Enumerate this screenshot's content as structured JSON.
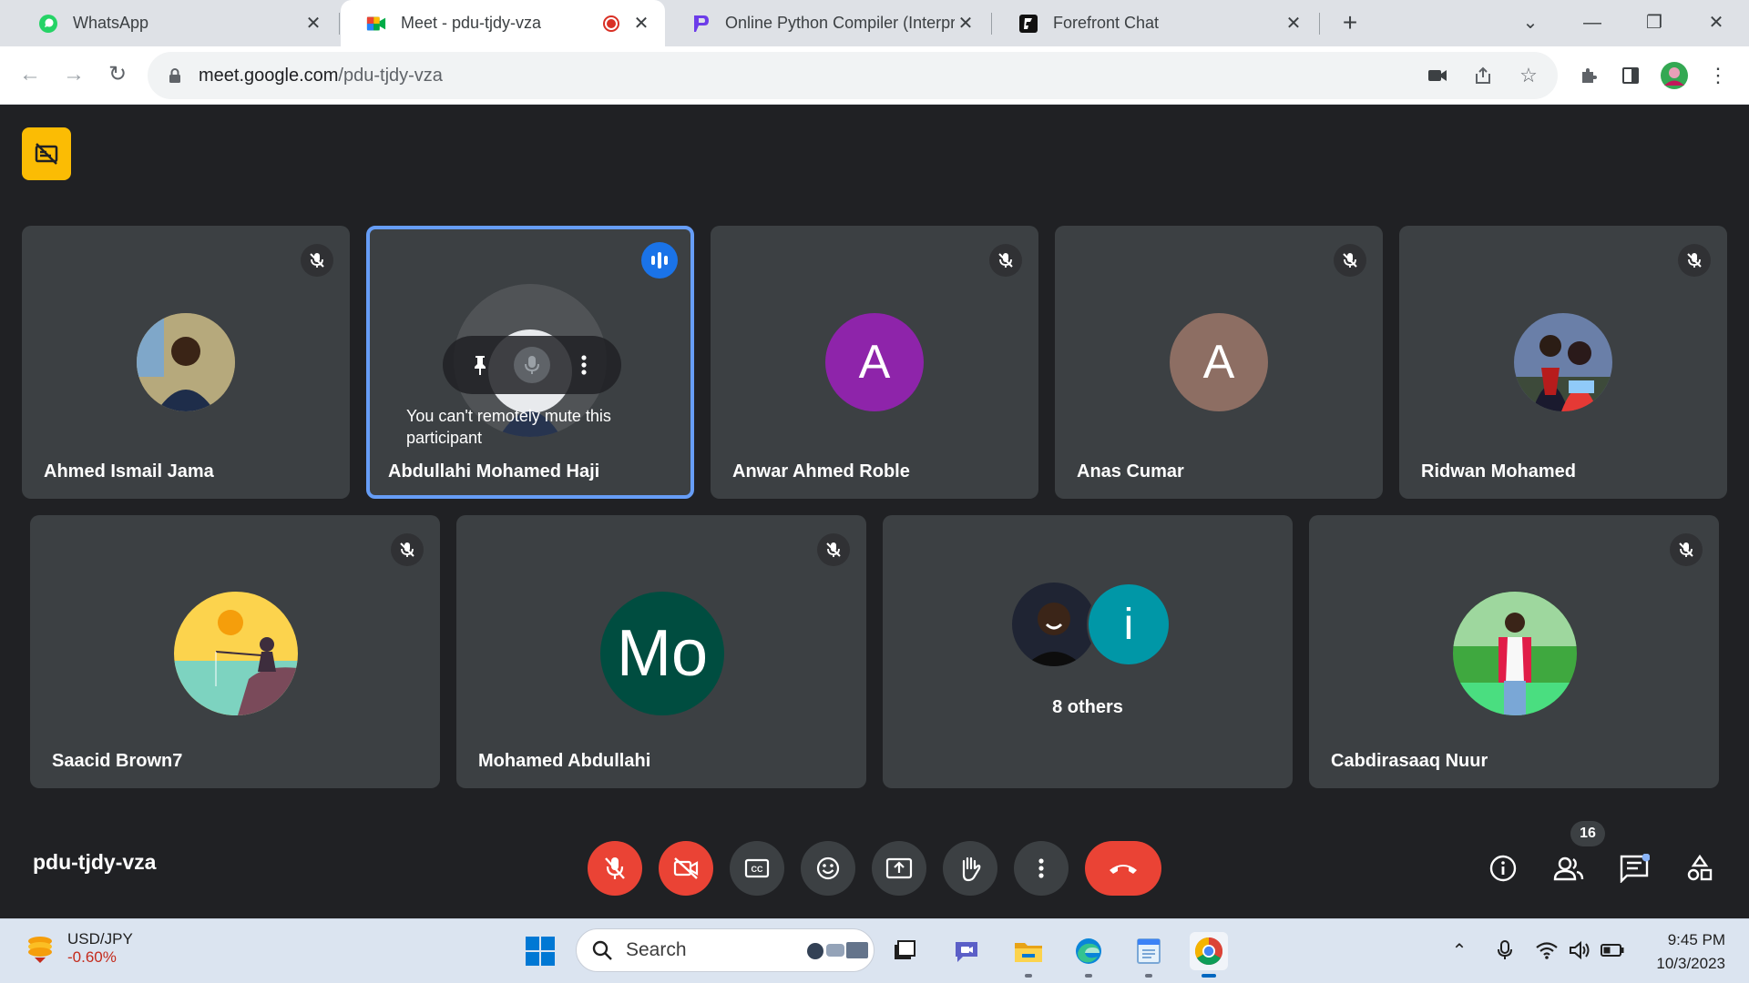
{
  "browser": {
    "tabs": [
      {
        "title": "WhatsApp",
        "icon": "whatsapp-icon"
      },
      {
        "title": "Meet - pdu-tjdy-vza",
        "icon": "google-meet-icon",
        "recording": true
      },
      {
        "title": "Online Python Compiler (Interpreter)",
        "icon": "programiz-icon"
      },
      {
        "title": "Forefront Chat",
        "icon": "forefront-icon"
      }
    ],
    "url_host": "meet.google.com",
    "url_path": "/pdu-tjdy-vza"
  },
  "meet": {
    "tooltip": "You can't remotely mute this participant",
    "participants_row1": [
      {
        "name": "Ahmed Ismail Jama",
        "avatar": "photo"
      },
      {
        "name": "Abdullahi Mohamed Haji",
        "avatar": "photo",
        "speaking": true
      },
      {
        "name": "Anwar Ahmed Roble",
        "avatar_letter": "A",
        "avatar_color": "#8e24aa"
      },
      {
        "name": "Anas Cumar",
        "avatar_letter": "A",
        "avatar_color": "#8d6e63"
      },
      {
        "name": "Ridwan Mohamed",
        "avatar": "photo"
      }
    ],
    "participants_row2": [
      {
        "name": "Saacid Brown7",
        "avatar": "illustration"
      },
      {
        "name": "Mohamed Abdullahi",
        "avatar_letter": "Mo",
        "avatar_color": "#004d40"
      },
      {
        "name": "8 others",
        "avatar_letter": "i",
        "avatar_color": "#0097a7"
      },
      {
        "name": "Cabdirasaaq Nuur",
        "avatar": "photo"
      }
    ],
    "meeting_code": "pdu-tjdy-vza",
    "people_count": "16"
  },
  "taskbar": {
    "ticker_symbol": "USD/JPY",
    "ticker_change": "-0.60%",
    "search_placeholder": "Search",
    "time": "9:45 PM",
    "date": "10/3/2023"
  }
}
